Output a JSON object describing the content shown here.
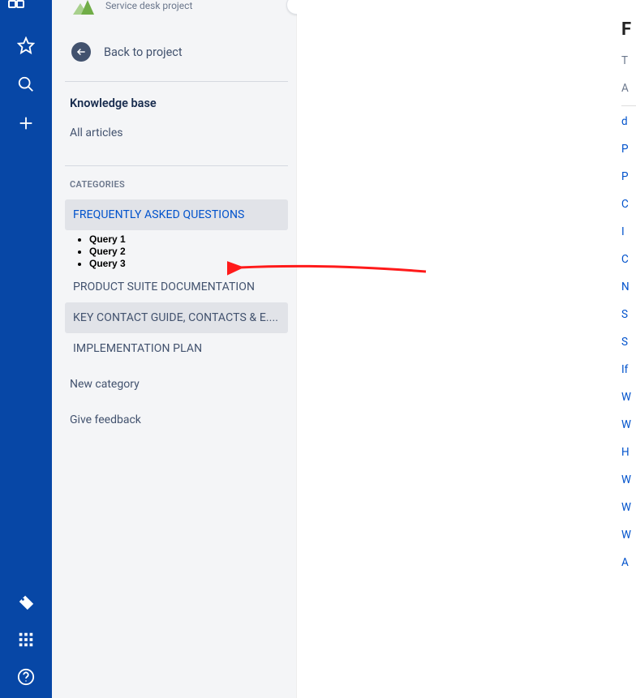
{
  "rail": {
    "icons": {
      "product_switcher": "product-switcher-icon",
      "star": "star-icon",
      "search": "search-icon",
      "create": "plus-icon",
      "tag": "tag-icon",
      "apps": "appswitcher-icon",
      "help": "help-icon"
    }
  },
  "sidebar": {
    "project_type": "Service desk project",
    "back_label": "Back to project",
    "kb_title": "Knowledge base",
    "all_articles": "All articles",
    "categories_heading": "CATEGORIES",
    "categories": [
      {
        "label": "FREQUENTLY ASKED QUESTIONS",
        "selected": true,
        "activeGrey": false
      },
      {
        "label": "PRODUCT SUITE DOCUMENTATION",
        "selected": false,
        "activeGrey": false
      },
      {
        "label": "KEY CONTACT GUIDE, CONTACTS & E....",
        "selected": false,
        "activeGrey": true
      },
      {
        "label": "IMPLEMENTATION PLAN",
        "selected": false,
        "activeGrey": false
      }
    ],
    "faq_queries": [
      "Query 1",
      "Query 2",
      "Query 3"
    ],
    "new_category": "New category",
    "give_feedback": "Give feedback"
  },
  "right_edge": {
    "headline_letter": "F",
    "lines": [
      {
        "text": "T",
        "style": "grey"
      },
      {
        "text": "A",
        "style": "grey"
      },
      {
        "text": "d",
        "style": "blue"
      },
      {
        "text": "P",
        "style": "blue"
      },
      {
        "text": "P",
        "style": "blue"
      },
      {
        "text": "C",
        "style": "blue"
      },
      {
        "text": "I",
        "style": "blue",
        "narrow": true
      },
      {
        "text": "C",
        "style": "blue"
      },
      {
        "text": "N",
        "style": "blue"
      },
      {
        "text": "S",
        "style": "blue"
      },
      {
        "text": "S",
        "style": "blue"
      },
      {
        "text": "If",
        "style": "blue"
      },
      {
        "text": "W",
        "style": "blue"
      },
      {
        "text": "W",
        "style": "blue"
      },
      {
        "text": "H",
        "style": "blue"
      },
      {
        "text": "W",
        "style": "blue"
      },
      {
        "text": "W",
        "style": "blue"
      },
      {
        "text": "W",
        "style": "blue"
      },
      {
        "text": "A",
        "style": "blue"
      }
    ]
  }
}
